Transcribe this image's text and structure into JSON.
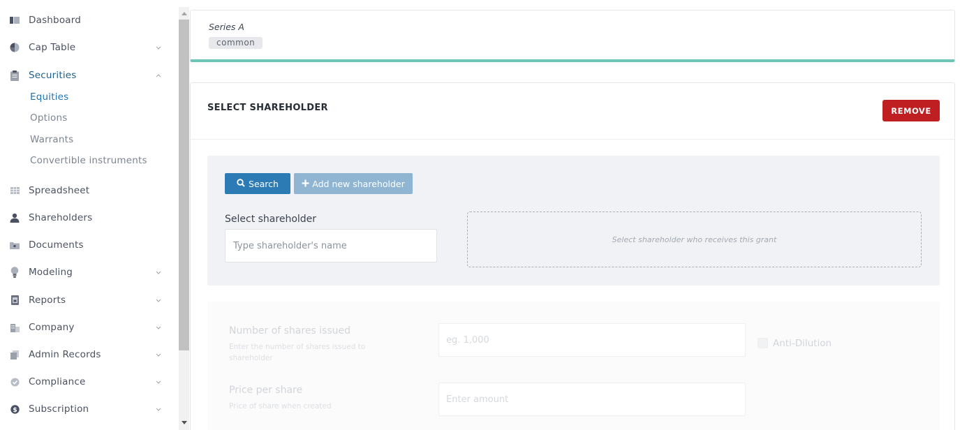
{
  "sidebar": {
    "items": [
      {
        "label": "Dashboard",
        "icon": "dashboard-icon"
      },
      {
        "label": "Cap Table",
        "icon": "pie-chart-icon",
        "chevron": "down"
      },
      {
        "label": "Securities",
        "icon": "clipboard-icon",
        "chevron": "up",
        "active": true
      },
      {
        "label": "Spreadsheet",
        "icon": "grid-icon"
      },
      {
        "label": "Shareholders",
        "icon": "user-icon"
      },
      {
        "label": "Documents",
        "icon": "folder-icon"
      },
      {
        "label": "Modeling",
        "icon": "lightbulb-icon",
        "chevron": "down"
      },
      {
        "label": "Reports",
        "icon": "report-icon",
        "chevron": "down"
      },
      {
        "label": "Company",
        "icon": "building-icon",
        "chevron": "down"
      },
      {
        "label": "Admin Records",
        "icon": "records-icon",
        "chevron": "down"
      },
      {
        "label": "Compliance",
        "icon": "shield-check-icon",
        "chevron": "down"
      },
      {
        "label": "Subscription",
        "icon": "dollar-icon",
        "chevron": "down"
      }
    ],
    "securities_sub": [
      {
        "label": "Equities",
        "active": true
      },
      {
        "label": "Options"
      },
      {
        "label": "Warrants"
      },
      {
        "label": "Convertible instruments"
      }
    ]
  },
  "series": {
    "name": "Series A",
    "tag": "common"
  },
  "shareholder_section": {
    "title": "SELECT SHAREHOLDER",
    "remove_label": "REMOVE",
    "search_label": "Search",
    "add_label": "Add new shareholder",
    "select_label": "Select shareholder",
    "select_placeholder": "Type shareholder's name",
    "dropzone_text": "Select shareholder who receives this grant"
  },
  "grant_fields": {
    "shares": {
      "label": "Number of shares issued",
      "help": "Enter the number of shares issued to shareholder",
      "placeholder": "eg. 1,000"
    },
    "anti_dilution_label": "Anti-Dilution",
    "price": {
      "label": "Price per share",
      "help": "Price of share when created",
      "placeholder": "Enter amount"
    }
  },
  "colors": {
    "accent_teal": "#6dc5b8",
    "primary_blue": "#2d7bb5",
    "remove_red": "#c01f21",
    "active_sub": "#1f73b1"
  }
}
